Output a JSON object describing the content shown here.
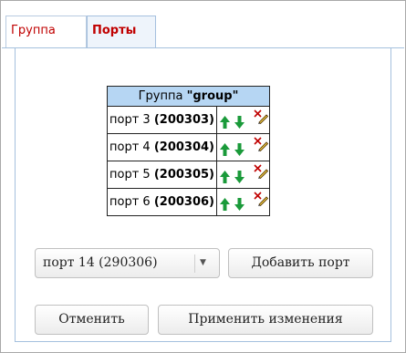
{
  "tabs": [
    {
      "label": "Группа"
    },
    {
      "label": "Порты"
    }
  ],
  "group_table": {
    "header_prefix": "Группа",
    "group_name": "\"group\"",
    "rows": [
      {
        "port": "порт 3",
        "id": "(200303)"
      },
      {
        "port": "порт 4",
        "id": "(200304)"
      },
      {
        "port": "порт 5",
        "id": "(200305)"
      },
      {
        "port": "порт 6",
        "id": "(200306)"
      }
    ]
  },
  "port_select": {
    "value": "порт 14 (290306)"
  },
  "buttons": {
    "add_port": "Добавить порт",
    "cancel": "Отменить",
    "apply": "Применить изменения"
  },
  "colors": {
    "tab_text": "#c00000",
    "table_header_bg": "#b6d6f3",
    "arrow_green": "#1a9a3a",
    "delete_red": "#c00000"
  },
  "icons": {
    "move_up": "arrow-up-icon",
    "move_down": "arrow-down-icon",
    "delete": "delete-icon"
  }
}
